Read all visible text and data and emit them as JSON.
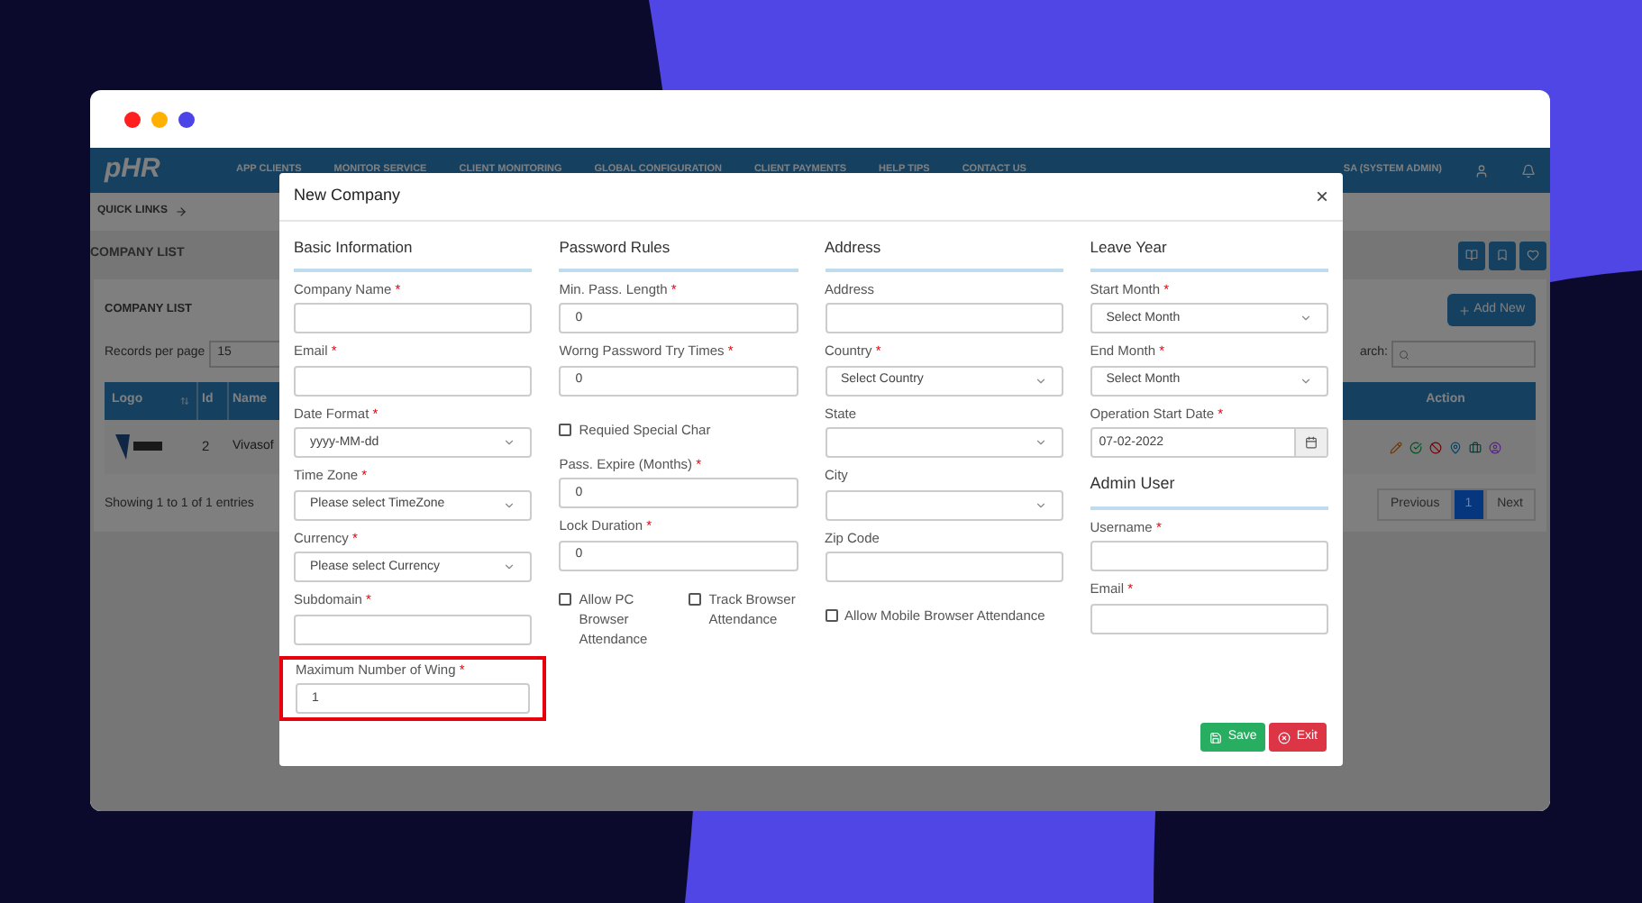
{
  "frame": {
    "dots": [
      {
        "color": "#ff1f1f"
      },
      {
        "color": "#ffb000"
      },
      {
        "color": "#4b44e6"
      }
    ]
  },
  "app": {
    "logo": "pHR",
    "menu": [
      "APP CLIENTS",
      "MONITOR SERVICE",
      "CLIENT MONITORING",
      "GLOBAL CONFIGURATION",
      "CLIENT PAYMENTS",
      "HELP TIPS",
      "CONTACT US"
    ],
    "user": "SA (SYSTEM ADMIN)",
    "quick_links": "QUICK LINKS",
    "page_title": "COMPANY LIST",
    "card_title": "COMPANY LIST",
    "add_button": "Add New",
    "records_label": "Records per page",
    "records_value": "15",
    "search_label": "arch:",
    "table": {
      "columns": [
        "Logo",
        "Id",
        "Name",
        "Action"
      ],
      "rows": [
        {
          "id": "2",
          "name": "Vivasof"
        }
      ]
    },
    "summary": "Showing 1 to 1 of 1 entries",
    "pagination": [
      {
        "label": "Previous",
        "selected": false
      },
      {
        "label": "1",
        "selected": true
      },
      {
        "label": "Next",
        "selected": false
      }
    ]
  },
  "modal": {
    "title": "New Company",
    "close": "×",
    "sections": [
      {
        "title": "Basic Information",
        "fields": [
          {
            "kind": "text",
            "label": "Company Name",
            "required_mark": "*",
            "highlighted": false
          },
          {
            "kind": "text",
            "label": "Email",
            "required_mark": "*",
            "highlighted": false
          },
          {
            "kind": "select",
            "label": "Date Format",
            "required_mark": "*",
            "value": "yyyy-MM-dd"
          },
          {
            "kind": "select",
            "label": "Time Zone",
            "required_mark": "*",
            "value": "Please select TimeZone"
          },
          {
            "kind": "select",
            "label": "Currency",
            "required_mark": "*",
            "value": "Please select Currency"
          },
          {
            "kind": "text",
            "label": "Subdomain",
            "required_mark": "*",
            "highlighted": false
          },
          {
            "kind": "text",
            "label": "Maximum Number of Wing",
            "required_mark": "*",
            "value": "1",
            "highlighted": true
          }
        ]
      },
      {
        "title": "Password Rules",
        "fields": [
          {
            "kind": "text",
            "label": "Min. Pass. Length",
            "required_mark": "*",
            "value": "0",
            "highlighted": false
          },
          {
            "kind": "text",
            "label": "Worng Password Try Times",
            "required_mark": "*",
            "value": "0",
            "highlighted": false
          },
          {
            "kind": "checkbox",
            "label": "Requied Special Char",
            "checked": false
          },
          {
            "kind": "text",
            "label": "Pass. Expire (Months)",
            "required_mark": "*",
            "value": "0",
            "highlighted": false
          },
          {
            "kind": "text",
            "label": "Lock Duration",
            "required_mark": "*",
            "value": "0",
            "highlighted": false
          },
          {
            "kind": "checkbox_row",
            "items": [
              {
                "label": "Allow PC Browser Attendance",
                "checked": false
              },
              {
                "label": "Track Browser Attendance",
                "checked": false
              }
            ]
          }
        ]
      },
      {
        "title": "Address",
        "fields": [
          {
            "kind": "text",
            "label": "Address",
            "highlighted": false
          },
          {
            "kind": "select",
            "label": "Country",
            "required_mark": "*",
            "value": "Select Country"
          },
          {
            "kind": "select",
            "label": "State"
          },
          {
            "kind": "select",
            "label": "City"
          },
          {
            "kind": "text",
            "label": "Zip Code",
            "highlighted": false
          },
          {
            "kind": "checkbox",
            "label": "Allow Mobile Browser Attendance",
            "checked": false
          }
        ]
      },
      {
        "title": "Leave Year",
        "fields": [
          {
            "kind": "select",
            "label": "Start Month",
            "required_mark": "*",
            "value": "Select Month"
          },
          {
            "kind": "select",
            "label": "End Month",
            "required_mark": "*",
            "value": "Select Month"
          },
          {
            "kind": "date",
            "label": "Operation Start Date",
            "required_mark": "*",
            "value": "07-02-2022"
          },
          {
            "kind": "heading",
            "label": "Admin User"
          },
          {
            "kind": "text",
            "label": "Username",
            "required_mark": "*",
            "highlighted": false
          },
          {
            "kind": "text",
            "label": "Email",
            "required_mark": "*",
            "highlighted": false
          }
        ]
      }
    ],
    "buttons": [
      {
        "label": "Save",
        "kind": "save"
      },
      {
        "label": "Exit",
        "kind": "exit"
      }
    ]
  }
}
